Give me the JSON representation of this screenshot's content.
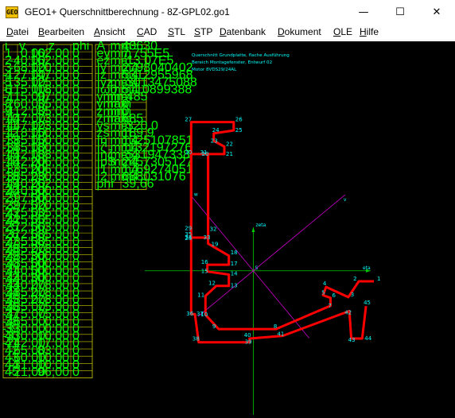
{
  "window": {
    "title": "GEO1+  Querschnittberechnung  -  8Z-GPL02.go1",
    "icon": "app-icon",
    "minimize_glyph": "—",
    "maximize_glyph": "☐",
    "close_glyph": "✕"
  },
  "menu": [
    {
      "first": "D",
      "rest": "atei"
    },
    {
      "first": "B",
      "rest": "earbeiten"
    },
    {
      "first": "A",
      "rest": "nsicht"
    },
    {
      "first": "C",
      "rest": "AD"
    },
    {
      "first": "S",
      "rest": "TL"
    },
    {
      "first": "S",
      "rest": "TP"
    },
    {
      "first": "D",
      "rest": "atenbank"
    },
    {
      "first": "D",
      "rest": "okument"
    },
    {
      "first": "O",
      "rest": "LE"
    },
    {
      "first": "H",
      "rest": "ilfe"
    }
  ],
  "colors": {
    "background": "#000000",
    "table_text": "#00ff00",
    "table_border": "#cccc00",
    "contour": "#ff0000",
    "labels": "#00ffff",
    "axes": "#00cc00",
    "principal_axes": "#cc00cc"
  },
  "coord_table": {
    "headers": [
      "i",
      "y",
      "z",
      "phi"
    ],
    "rows": [
      [
        "1",
        "0,00",
        "162,00",
        "0"
      ],
      [
        "2",
        "-40,00",
        "162,00",
        "0"
      ],
      [
        "3",
        "-68,00",
        "120,00",
        "0"
      ],
      [
        "4",
        "-127,00",
        "147,00",
        "0"
      ],
      [
        "5",
        "-135,00",
        "125,00",
        "0"
      ],
      [
        "6",
        "-115,00",
        "118,00",
        "0"
      ],
      [
        "7",
        "-115,00",
        "97,00",
        "0"
      ],
      [
        "8",
        "-260,00",
        "35,00",
        "0"
      ],
      [
        "9",
        "-412,00",
        "35,00",
        "0"
      ],
      [
        "10",
        "-447,00",
        "73,00",
        "0"
      ],
      [
        "11",
        "-447,00",
        "123,00",
        "0"
      ],
      [
        "12",
        "-418,00",
        "150,00",
        "0"
      ],
      [
        "13",
        "-385,00",
        "150,00",
        "0"
      ],
      [
        "14",
        "-385,00",
        "180,00",
        "0"
      ],
      [
        "15",
        "-442,00",
        "188,00",
        "0"
      ],
      [
        "16",
        "-442,00",
        "206,00",
        "0"
      ],
      [
        "17",
        "-385,00",
        "206,00",
        "0"
      ],
      [
        "18",
        "-385,00",
        "230,00",
        "0"
      ],
      [
        "19",
        "-440,00",
        "262,00",
        "0"
      ],
      [
        "20",
        "-440,00",
        "500,00",
        "0"
      ],
      [
        "21",
        "-397,00",
        "500,00",
        "0"
      ],
      [
        "22",
        "-397,00",
        "520,00",
        "0"
      ],
      [
        "23",
        "-425,00",
        "535,00",
        "0"
      ],
      [
        "24",
        "-425,00",
        "555,00",
        "0"
      ],
      [
        "25",
        "-372,00",
        "563,00",
        "0"
      ],
      [
        "26",
        "-372,00",
        "585,00",
        "0"
      ],
      [
        "27",
        "-485,00",
        "585,00",
        "0"
      ],
      [
        "28",
        "-485,00",
        "278,00",
        "0"
      ],
      [
        "29",
        "-485,00",
        "300,00",
        "0"
      ],
      [
        "30",
        "-485,00",
        "500,00",
        "0"
      ],
      [
        "31",
        "-440,00",
        "500,00",
        "0"
      ],
      [
        "32",
        "-440,00",
        "300,00",
        "0"
      ],
      [
        "33",
        "-440,00",
        "278,00",
        "0"
      ],
      [
        "34",
        "-485,00",
        "278,00",
        "0"
      ],
      [
        "35",
        "-485,00",
        "278,00",
        "0"
      ],
      [
        "36",
        "-485,00",
        "75,00",
        "0"
      ],
      [
        "37",
        "-475,00",
        "75,00",
        "0"
      ],
      [
        "38",
        "-465,00",
        "0,00",
        "0"
      ],
      [
        "39",
        "-330,00",
        "0,00",
        "0"
      ],
      [
        "40",
        "-330,00",
        "10,00",
        "0"
      ],
      [
        "41",
        "-242,00",
        "17,00",
        "0"
      ],
      [
        "42",
        "-65,00",
        "83,00",
        "0"
      ],
      [
        "43",
        "-60,00",
        "10,00",
        "0"
      ],
      [
        "44",
        "-31,00",
        "10,00",
        "0"
      ],
      [
        "45",
        "-21,00",
        "96,00",
        "0"
      ]
    ]
  },
  "props_table": {
    "rows": [
      [
        "A",
        "mm²",
        "40630"
      ],
      [
        "ey",
        "mm",
        "7,755E5"
      ],
      [
        "ez",
        "mm",
        "-13,07E5"
      ],
      [
        "Iy",
        "mm4",
        "2798040402"
      ],
      [
        "Iz",
        "mm4",
        "5312955968"
      ],
      [
        "Iyz",
        "mm4",
        "-3013475088"
      ],
      [
        "Iω0",
        "mm4",
        "5110899388"
      ],
      [
        "ymin",
        "mm",
        "-485"
      ],
      [
        "ymax",
        "mm",
        "0"
      ],
      [
        "zmin",
        "mm",
        "0"
      ],
      [
        "zmax",
        "mm",
        "585"
      ],
      [
        "ys",
        "mm",
        "-320,0"
      ],
      [
        "zs",
        "mm",
        "189,9"
      ],
      [
        "Iη",
        "mm4",
        "1325107851"
      ],
      [
        "Iζ",
        "mm4",
        "1132197276"
      ],
      [
        "Iηζ",
        "mm4",
        "-531947338"
      ],
      [
        "IpS",
        "mm4",
        "2457305127"
      ],
      [
        "I1",
        "mm4",
        "1769274051"
      ],
      [
        "I2",
        "mm4",
        "688031076"
      ],
      [
        "phi",
        "°",
        "39,66"
      ]
    ]
  },
  "notes": [
    "Querschnitt Grundplatte, flache Ausführung",
    "Bereich Montagefenster, Entwurf 02",
    "Motor 8VDS29/24AL"
  ],
  "axis_labels": {
    "zeta": "zeta",
    "eta": "eta",
    "v": "v",
    "w": "w",
    "S": "S"
  },
  "point_labels": [
    {
      "n": "1"
    },
    {
      "n": "2"
    },
    {
      "n": "3"
    },
    {
      "n": "4"
    },
    {
      "n": "5"
    },
    {
      "n": "6"
    },
    {
      "n": "7"
    },
    {
      "n": "8"
    },
    {
      "n": "9"
    },
    {
      "n": "10"
    },
    {
      "n": "11"
    },
    {
      "n": "12"
    },
    {
      "n": "13"
    },
    {
      "n": "14"
    },
    {
      "n": "15"
    },
    {
      "n": "16"
    },
    {
      "n": "17"
    },
    {
      "n": "18"
    },
    {
      "n": "19"
    },
    {
      "n": "20"
    },
    {
      "n": "21"
    },
    {
      "n": "22"
    },
    {
      "n": "23"
    },
    {
      "n": "24"
    },
    {
      "n": "25"
    },
    {
      "n": "26"
    },
    {
      "n": "27"
    },
    {
      "n": "28"
    },
    {
      "n": "29"
    },
    {
      "n": "30"
    },
    {
      "n": "31"
    },
    {
      "n": "32"
    },
    {
      "n": "33"
    },
    {
      "n": "34"
    },
    {
      "n": "35"
    },
    {
      "n": "36"
    },
    {
      "n": "37"
    },
    {
      "n": "38"
    },
    {
      "n": "39"
    },
    {
      "n": "40"
    },
    {
      "n": "41"
    },
    {
      "n": "42"
    },
    {
      "n": "43"
    },
    {
      "n": "44"
    },
    {
      "n": "45"
    }
  ]
}
